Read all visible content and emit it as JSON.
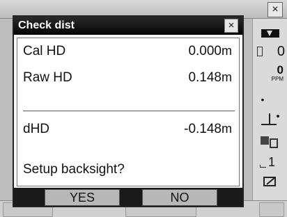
{
  "background": {
    "close_glyph": "×",
    "panel": {
      "battery_icon": "battery-icon",
      "value_1": "0",
      "value_2": "0",
      "value_2_unit": "PPM",
      "bullet": "•",
      "instrument_icon": "instrument-height-icon",
      "target_icon": "target-icon",
      "value_3": "1",
      "edit_icon": "edit-icon"
    }
  },
  "dialog": {
    "title": "Check dist",
    "close_glyph": "×",
    "rows": [
      {
        "label": "Cal HD",
        "value": "0.000",
        "unit": "m"
      },
      {
        "label": "Raw HD",
        "value": "0.148",
        "unit": "m"
      },
      {
        "label": "dHD",
        "value": "-0.148",
        "unit": "m"
      }
    ],
    "prompt": "Setup backsight?",
    "buttons": {
      "yes": "YES",
      "no": "NO"
    }
  }
}
